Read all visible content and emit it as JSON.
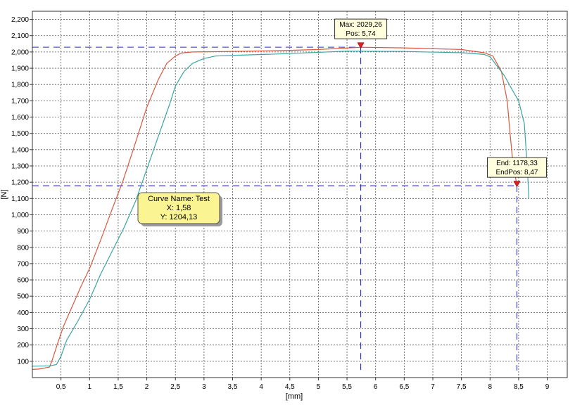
{
  "chart_data": {
    "type": "line",
    "xlabel": "[mm]",
    "ylabel": "[N]",
    "xlim": [
      0,
      9.35
    ],
    "ylim": [
      0,
      2250
    ],
    "xticks": [
      0.5,
      1,
      1.5,
      2,
      2.5,
      3,
      3.5,
      4,
      4.5,
      5,
      5.5,
      6,
      6.5,
      7,
      7.5,
      8,
      8.5,
      9
    ],
    "xtick_labels": [
      "0,5",
      "1",
      "1,5",
      "2",
      "2,5",
      "3",
      "3,5",
      "4",
      "4,5",
      "5",
      "5,5",
      "6",
      "6,5",
      "7",
      "7,5",
      "8",
      "8,5",
      "9"
    ],
    "yticks": [
      100,
      200,
      300,
      400,
      500,
      600,
      700,
      800,
      900,
      1000,
      1100,
      1200,
      1300,
      1400,
      1500,
      1600,
      1700,
      1800,
      1900,
      2000,
      2100,
      2200
    ],
    "ytick_labels": [
      "100",
      "200",
      "300",
      "400",
      "500",
      "600",
      "700",
      "800",
      "900",
      "1,000",
      "1,100",
      "1,200",
      "1,300",
      "1,400",
      "1,500",
      "1,600",
      "1,700",
      "1,800",
      "1,900",
      "2,000",
      "2,100",
      "2,200"
    ],
    "grid": true,
    "series": [
      {
        "color": "#d9573c",
        "points": [
          [
            0,
            50
          ],
          [
            0.1,
            52
          ],
          [
            0.2,
            58
          ],
          [
            0.3,
            65
          ],
          [
            0.35,
            110
          ],
          [
            0.45,
            220
          ],
          [
            0.55,
            320
          ],
          [
            0.65,
            400
          ],
          [
            0.75,
            480
          ],
          [
            0.85,
            560
          ],
          [
            1.0,
            670
          ],
          [
            1.2,
            850
          ],
          [
            1.4,
            1040
          ],
          [
            1.58,
            1204
          ],
          [
            1.8,
            1440
          ],
          [
            2.0,
            1660
          ],
          [
            2.2,
            1830
          ],
          [
            2.35,
            1930
          ],
          [
            2.5,
            1975
          ],
          [
            2.6,
            1993
          ],
          [
            2.8,
            2000
          ],
          [
            3.5,
            2003
          ],
          [
            4.5,
            2010
          ],
          [
            5.0,
            2015
          ],
          [
            5.74,
            2029
          ],
          [
            6.5,
            2025
          ],
          [
            7.5,
            2015
          ],
          [
            7.9,
            1995
          ],
          [
            8.05,
            1975
          ],
          [
            8.2,
            1880
          ],
          [
            8.3,
            1700
          ],
          [
            8.35,
            1500
          ],
          [
            8.4,
            1320
          ],
          [
            8.47,
            1178
          ]
        ]
      },
      {
        "color": "#3aa5a0",
        "points": [
          [
            0,
            70
          ],
          [
            0.3,
            72
          ],
          [
            0.42,
            80
          ],
          [
            0.5,
            130
          ],
          [
            0.6,
            230
          ],
          [
            0.8,
            350
          ],
          [
            1.0,
            480
          ],
          [
            1.2,
            640
          ],
          [
            1.4,
            780
          ],
          [
            1.6,
            920
          ],
          [
            1.8,
            1080
          ],
          [
            2.0,
            1280
          ],
          [
            2.2,
            1480
          ],
          [
            2.4,
            1680
          ],
          [
            2.5,
            1790
          ],
          [
            2.65,
            1880
          ],
          [
            2.8,
            1930
          ],
          [
            3.0,
            1960
          ],
          [
            3.2,
            1975
          ],
          [
            3.6,
            1980
          ],
          [
            4.5,
            1990
          ],
          [
            5.5,
            2005
          ],
          [
            6.5,
            2003
          ],
          [
            7.5,
            1995
          ],
          [
            7.9,
            1985
          ],
          [
            8.0,
            1970
          ],
          [
            8.25,
            1855
          ],
          [
            8.4,
            1760
          ],
          [
            8.5,
            1700
          ],
          [
            8.6,
            1560
          ],
          [
            8.65,
            1300
          ],
          [
            8.68,
            1100
          ]
        ]
      }
    ],
    "annotations": {
      "max": {
        "line1": "Max: 2029,26",
        "line2": "Pos: 5,74",
        "x": 5.74,
        "y": 2029.26
      },
      "end": {
        "line1": "End: 1178,33",
        "line2": "EndPos: 8,47",
        "x": 8.47,
        "y": 1178.33
      },
      "tooltip": {
        "line1": "Curve Name: Test",
        "line2": "X: 1,58",
        "line3": "Y: 1204,13",
        "x": 1.58,
        "y": 1204.13
      }
    }
  }
}
